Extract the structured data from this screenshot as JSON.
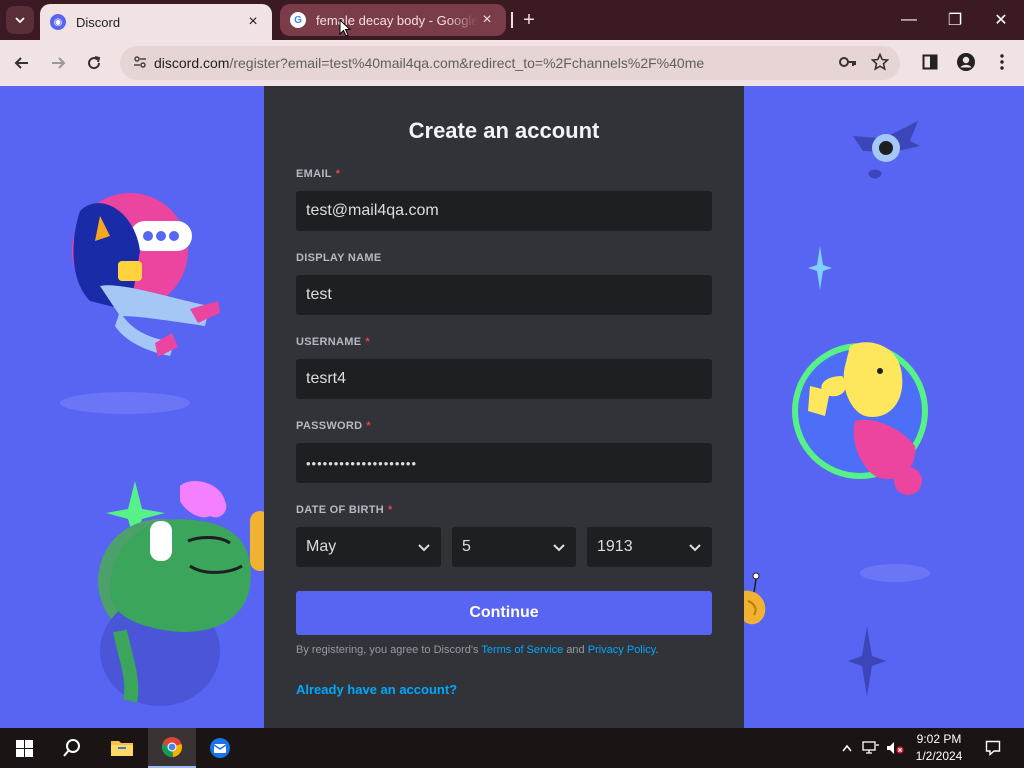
{
  "browser": {
    "tabs": [
      {
        "title": "Discord",
        "active": true
      },
      {
        "title": "female decay body - Google Search",
        "active": false
      }
    ],
    "url_host": "discord.com",
    "url_rest": "/register?email=test%40mail4qa.com&redirect_to=%2Fchannels%2F%40me",
    "new_tab_icon": "+",
    "window_controls": {
      "minimize": "—",
      "restore": "❐",
      "close": "✕"
    }
  },
  "form": {
    "title": "Create an account",
    "email": {
      "label": "EMAIL",
      "required": "*",
      "value": "test@mail4qa.com"
    },
    "display_name": {
      "label": "DISPLAY NAME",
      "value": "test"
    },
    "username": {
      "label": "USERNAME",
      "required": "*",
      "value": "tesrt4"
    },
    "password": {
      "label": "PASSWORD",
      "required": "*",
      "value": "••••••••••••••••••••"
    },
    "dob": {
      "label": "DATE OF BIRTH",
      "required": "*",
      "month": "May",
      "day": "5",
      "year": "1913"
    },
    "continue_label": "Continue",
    "terms": {
      "prefix": "By registering, you agree to Discord's",
      "tos": "Terms of Service",
      "and": "and",
      "privacy": "Privacy Policy",
      "suffix": "."
    },
    "login_link": "Already have an account?"
  },
  "taskbar": {
    "time": "9:02 PM",
    "date": "1/2/2024"
  },
  "colors": {
    "blurple": "#5865f2",
    "card": "#313338",
    "input": "#1e1f22",
    "link": "#00a8fc",
    "required": "#f23f42"
  }
}
